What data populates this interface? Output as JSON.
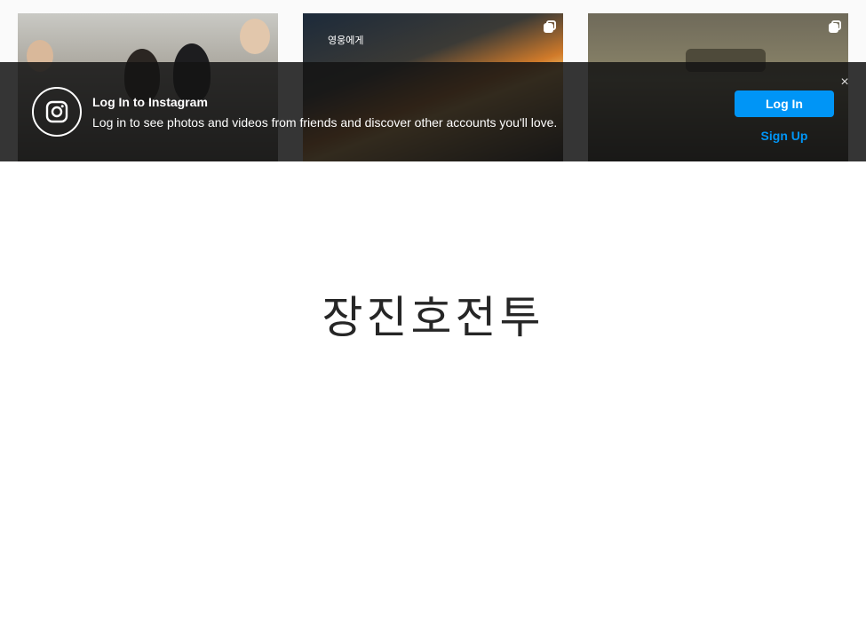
{
  "grid": {
    "tile_2_overlay_text": "영웅에게"
  },
  "banner": {
    "logo_icon": "instagram-logo-icon",
    "title": "Log In to Instagram",
    "subtitle": "Log in to see photos and videos from friends and discover other accounts you'll love.",
    "login_label": "Log In",
    "signup_label": "Sign Up",
    "close_glyph": "×",
    "accent_color": "#0095f6"
  },
  "main": {
    "headline": "장진호전투"
  }
}
